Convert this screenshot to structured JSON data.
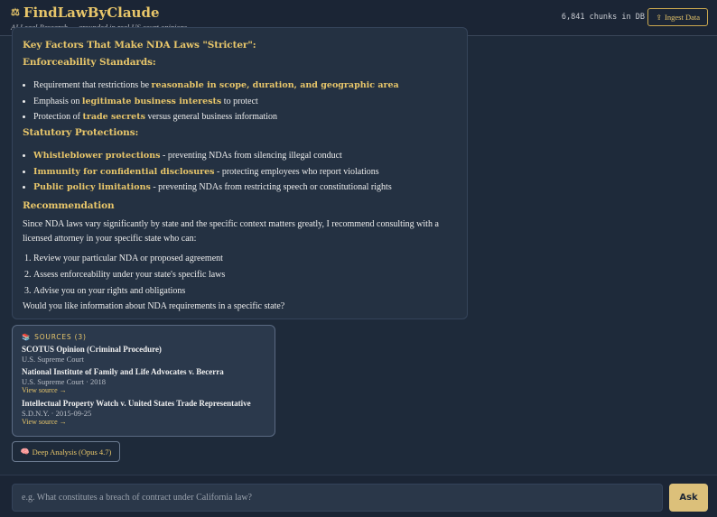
{
  "header": {
    "title": "FindLawByClaude",
    "subtitle": "AI Legal Research — grounded in real US court opinions",
    "chunks_text": "6,841 chunks in DB",
    "ingest_label": "Ingest Data",
    "logo_icon": "scales-icon",
    "ingest_icon": "upload-icon"
  },
  "answer": {
    "heading_key_factors": "Key Factors That Make NDA Laws \"Stricter\":",
    "enforceability_heading": "Enforceability Standards:",
    "enforceability_items": [
      {
        "pre": "Requirement that restrictions be ",
        "hl": "reasonable in scope, duration, and geographic area",
        "post": ""
      },
      {
        "pre": "Emphasis on ",
        "hl": "legitimate business interests",
        "post": " to protect"
      },
      {
        "pre": "Protection of ",
        "hl": "trade secrets",
        "post": " versus general business information"
      }
    ],
    "statutory_heading": "Statutory Protections:",
    "statutory_items": [
      {
        "hl": "Whistleblower protections",
        "post": " - preventing NDAs from silencing illegal conduct"
      },
      {
        "hl": "Immunity for confidential disclosures",
        "post": " - protecting employees who report violations"
      },
      {
        "hl": "Public policy limitations",
        "post": " - preventing NDAs from restricting speech or constitutional rights"
      }
    ],
    "recommendation_heading": "Recommendation",
    "recommendation_text": "Since NDA laws vary significantly by state and the specific context matters greatly, I recommend consulting with a licensed attorney in your specific state who can:",
    "steps": [
      "Review your particular NDA or proposed agreement",
      "Assess enforceability under your state's specific laws",
      "Advise you on your rights and obligations"
    ],
    "closing": "Would you like information about NDA requirements in a specific state?"
  },
  "sources": {
    "heading": "SOURCES (3)",
    "icon": "books-icon",
    "items": [
      {
        "title": "SCOTUS Opinion (Criminal Procedure)",
        "court": "U.S. Supreme Court",
        "link": ""
      },
      {
        "title": "National Institute of Family and Life Advocates v. Becerra",
        "court": "U.S. Supreme Court · 2018",
        "link": "View source →"
      },
      {
        "title": "Intellectual Property Watch v. United States Trade Representative",
        "court": "S.D.N.Y. · 2015-09-25",
        "link": "View source →"
      }
    ]
  },
  "deep_analysis_label": "Deep Analysis (Opus 4.7)",
  "query": {
    "placeholder": "e.g. What constitutes a breach of contract under California law?",
    "value": "",
    "ask_label": "Ask"
  },
  "colors": {
    "accent": "#e8c66a",
    "background": "#1e2a3a",
    "card": "#243142",
    "ask_button": "#dcc07a"
  }
}
